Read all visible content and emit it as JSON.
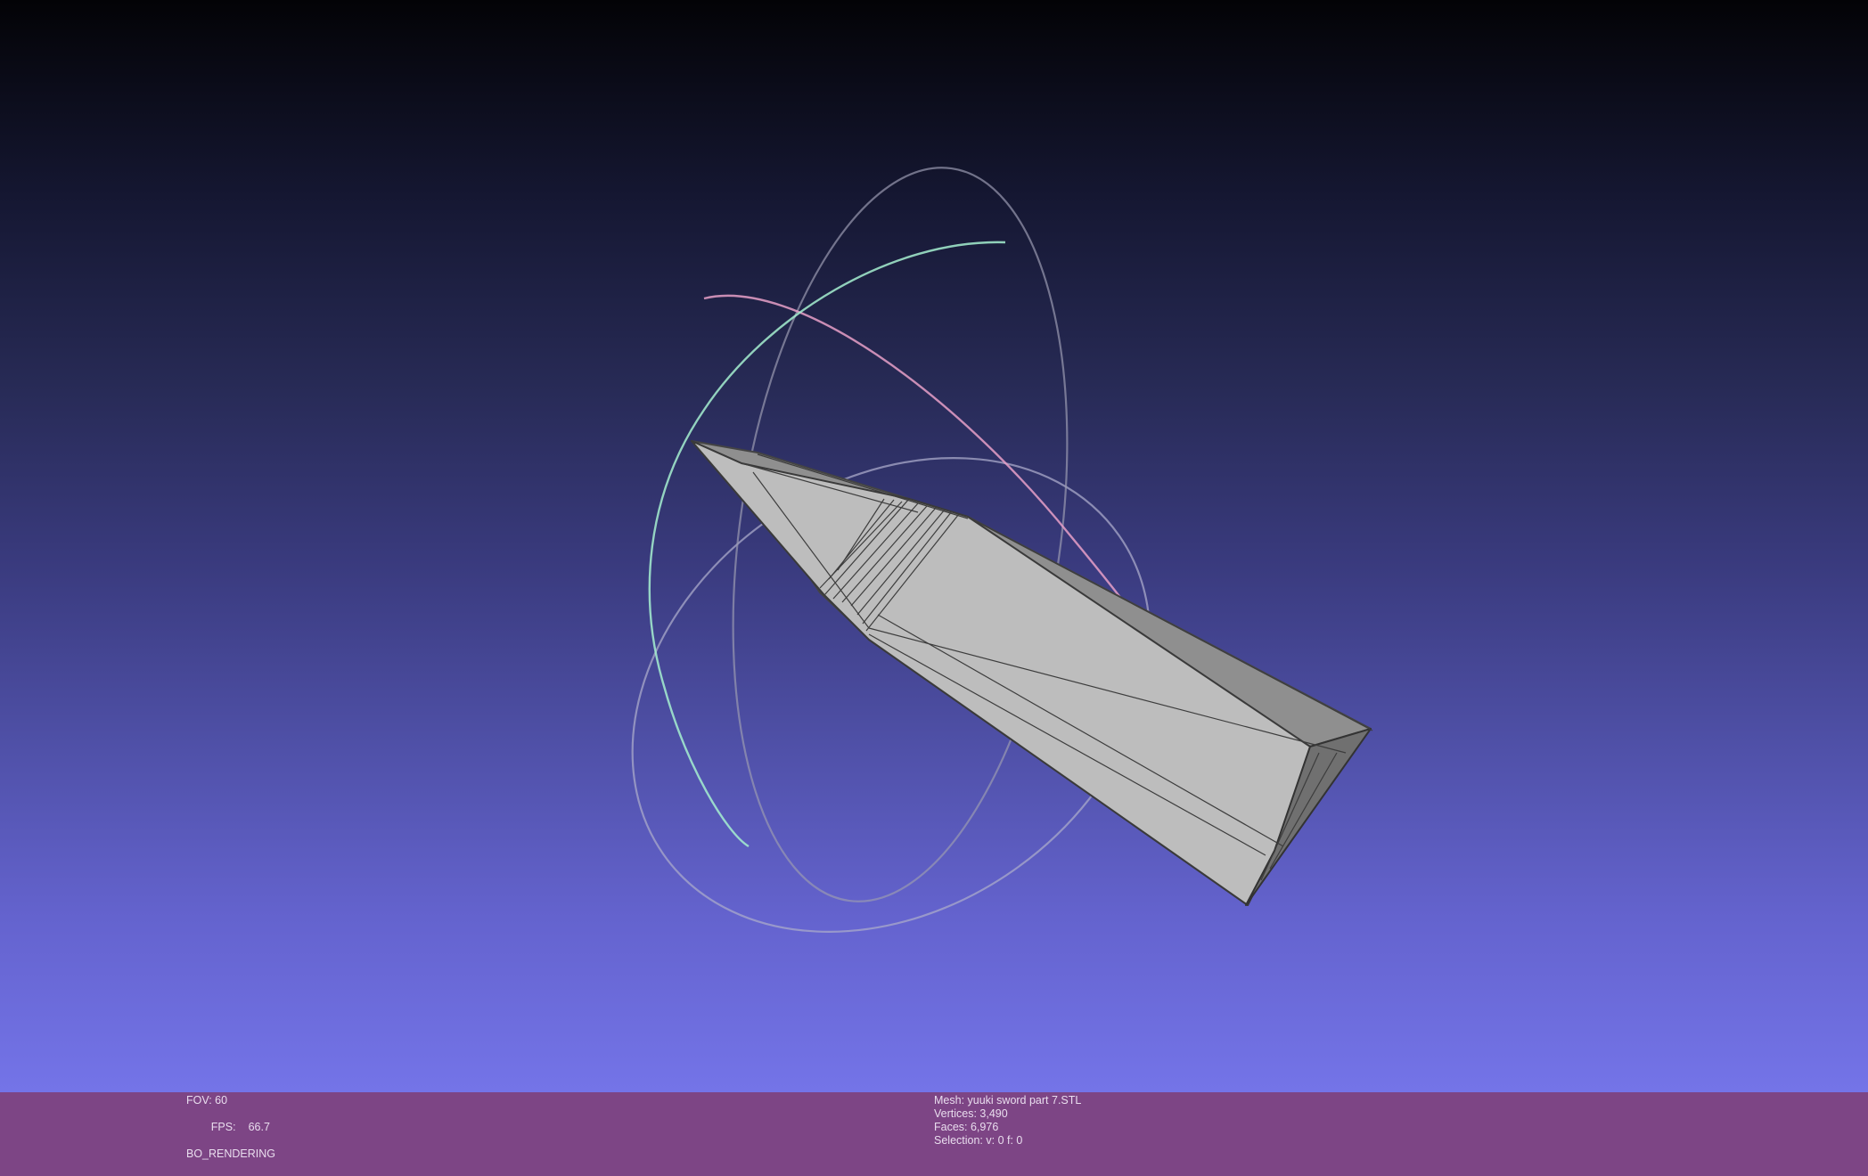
{
  "viewer": {
    "background_top_color": "#030306",
    "background_bottom_color": "#7474e8",
    "info_bar_color": "#7d4585",
    "mesh_color": "#b9b9bb"
  },
  "info_left": {
    "fov": "FOV: 60",
    "fps_label": "FPS:",
    "fps_value": "66.7",
    "render_mode": "BO_RENDERING"
  },
  "info_right": {
    "mesh": "Mesh: yuuki sword part 7.STL",
    "vertices": "Vertices: 3,490",
    "faces": "Faces: 6,976",
    "selection": "Selection: v: 0 f: 0"
  },
  "icons": {
    "trackball": "trackball-gizmo-icon"
  }
}
